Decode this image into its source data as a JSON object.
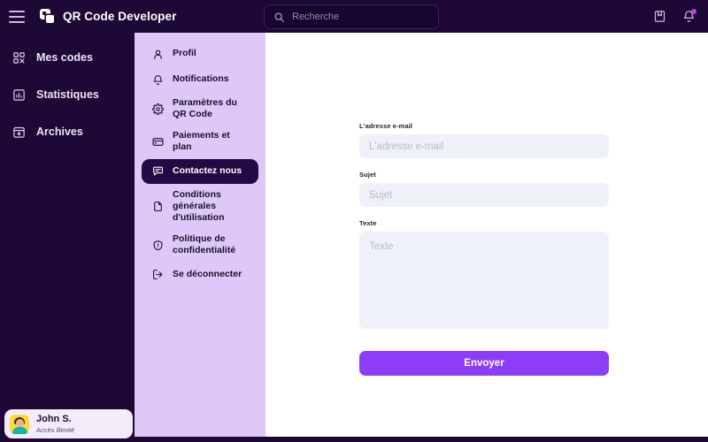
{
  "header": {
    "menu_icon": "hamburger-icon",
    "brand": "QR Code Developer",
    "logo_icon": "qr-logo-icon",
    "search": {
      "placeholder": "Recherche",
      "value": "",
      "icon": "search-icon"
    },
    "actions": [
      {
        "name": "bookmark-icon",
        "label": "bookmark"
      },
      {
        "name": "bell-icon",
        "label": "notifications",
        "badge": true
      }
    ],
    "accent": "#c43fe0"
  },
  "sidebar": {
    "background": "#1d0836",
    "items": [
      {
        "label": "Mes codes",
        "icon": "qr-grid-icon"
      },
      {
        "label": "Statistiques",
        "icon": "bar-chart-icon"
      },
      {
        "label": "Archives",
        "icon": "archive-icon"
      }
    ],
    "user": {
      "name": "John S.",
      "subtitle": "Accès illimité",
      "avatar_icon": "user-avatar"
    }
  },
  "subnav": {
    "background": "#ddc8f7",
    "active_background": "#240a44",
    "items": [
      {
        "label": "Profil",
        "icon": "person-icon",
        "active": false
      },
      {
        "label": "Notifications",
        "icon": "bell-icon",
        "active": false
      },
      {
        "label": "Paramètres du QR Code",
        "icon": "gear-icon",
        "active": false
      },
      {
        "label": "Paiements et plan",
        "icon": "credit-card-icon",
        "active": false
      },
      {
        "label": "Contactez nous",
        "icon": "message-icon",
        "active": true
      },
      {
        "label": "Conditions générales d'utilisation",
        "icon": "document-icon",
        "active": false
      },
      {
        "label": "Politique de confidentialité",
        "icon": "shield-icon",
        "active": false
      },
      {
        "label": "Se déconnecter",
        "icon": "logout-icon",
        "active": false
      }
    ]
  },
  "main": {
    "form": {
      "email": {
        "label": "L'adresse e-mail",
        "placeholder": "L'adresse e-mail",
        "value": ""
      },
      "subject": {
        "label": "Sujet",
        "placeholder": "Sujet",
        "value": ""
      },
      "text": {
        "label": "Texte",
        "placeholder": "Texte",
        "value": ""
      },
      "submit_label": "Envoyer",
      "submit_color": "#8b3ef5"
    }
  }
}
